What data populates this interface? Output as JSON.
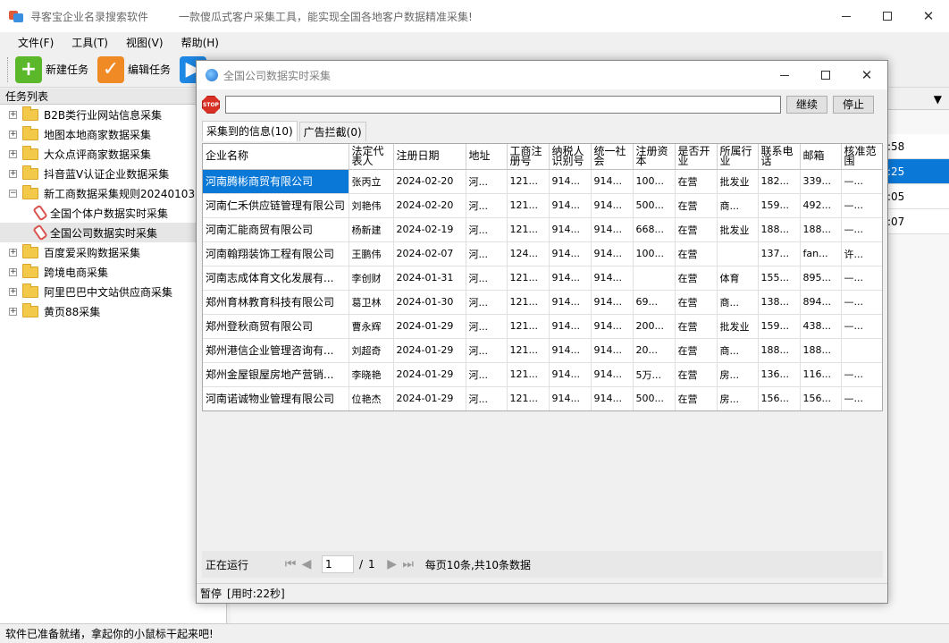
{
  "app": {
    "title": "寻客宝企业名录搜索软件",
    "subtitle": "一款傻瓜式客户采集工具，能实现全国各地客户数据精准采集!"
  },
  "menu": [
    "文件(F)",
    "工具(T)",
    "视图(V)",
    "帮助(H)"
  ],
  "toolbar": {
    "new_task": "新建任务",
    "edit_task": "编辑任务"
  },
  "sidebar": {
    "header": "任务列表",
    "items": [
      {
        "label": "B2B类行业网站信息采集",
        "expander": "+"
      },
      {
        "label": "地图本地商家数据采集",
        "expander": "+"
      },
      {
        "label": "大众点评商家数据采集",
        "expander": "+"
      },
      {
        "label": "抖音蓝V认证企业数据采集",
        "expander": "+"
      },
      {
        "label": "新工商数据采集规则20240103",
        "expander": "−"
      },
      {
        "label": "全国个体户数据实时采集",
        "child": true
      },
      {
        "label": "全国公司数据实时采集",
        "child": true,
        "selected": true
      },
      {
        "label": "百度爱采购数据采集",
        "expander": "+"
      },
      {
        "label": "跨境电商采集",
        "expander": "+"
      },
      {
        "label": "阿里巴巴中文站供应商采集",
        "expander": "+"
      },
      {
        "label": "黄页88采集",
        "expander": "+"
      }
    ]
  },
  "background_cells": [
    ":58",
    ":25",
    ":05",
    ":07"
  ],
  "status_bar": "软件已准备就绪，拿起你的小鼠标干起来吧!",
  "dialog": {
    "title": "全国公司数据实时采集",
    "stop_icon_text": "STOP",
    "url_value": "",
    "continue_label": "继续",
    "stop_label": "停止",
    "tabs": [
      "采集到的信息(10)",
      "广告拦截(0)"
    ],
    "columns": [
      "企业名称",
      "法定代表人",
      "注册日期",
      "地址",
      "工商注册号",
      "纳税人识别号",
      "统一社会",
      "注册资本",
      "是否开业",
      "所属行业",
      "联系电话",
      "邮箱",
      "核准范围"
    ],
    "rows": [
      [
        "河南腾彬商贸有限公司",
        "张丙立",
        "2024-02-20",
        "河...",
        "121...",
        "914...",
        "914...",
        "100...",
        "在营",
        "批发业",
        "182...",
        "339...",
        "—..."
      ],
      [
        "河南仁禾供应链管理有限公司",
        "刘艳伟",
        "2024-02-20",
        "河...",
        "121...",
        "914...",
        "914...",
        "500...",
        "在营",
        "商...",
        "159...",
        "492...",
        "—..."
      ],
      [
        "河南汇能商贸有限公司",
        "杨新建",
        "2024-02-19",
        "河...",
        "121...",
        "914...",
        "914...",
        "668...",
        "在营",
        "批发业",
        "188...",
        "188...",
        "—..."
      ],
      [
        "河南翰翔装饰工程有限公司",
        "王鹏伟",
        "2024-02-07",
        "河...",
        "124...",
        "914...",
        "914...",
        "100...",
        "在营",
        "",
        "137...",
        "fan...",
        "许..."
      ],
      [
        "河南志成体育文化发展有...",
        "李创财",
        "2024-01-31",
        "河...",
        "121...",
        "914...",
        "914...",
        "",
        "在营",
        "体育",
        "155...",
        "895...",
        "—..."
      ],
      [
        "郑州育林教育科技有限公司",
        "葛卫林",
        "2024-01-30",
        "河...",
        "121...",
        "914...",
        "914...",
        "69...",
        "在营",
        "商...",
        "138...",
        "894...",
        "—..."
      ],
      [
        "郑州登秋商贸有限公司",
        "曹永辉",
        "2024-01-29",
        "河...",
        "121...",
        "914...",
        "914...",
        "200...",
        "在营",
        "批发业",
        "159...",
        "438...",
        "—..."
      ],
      [
        "郑州港信企业管理咨询有...",
        "刘超奇",
        "2024-01-29",
        "河...",
        "121...",
        "914...",
        "914...",
        "20...",
        "在营",
        "商...",
        "188...",
        "188...",
        ""
      ],
      [
        "郑州金屋银屋房地产营销...",
        "李晓艳",
        "2024-01-29",
        "河...",
        "121...",
        "914...",
        "914...",
        "5万...",
        "在营",
        "房...",
        "136...",
        "116...",
        "—..."
      ],
      [
        "河南诺诚物业管理有限公司",
        "位艳杰",
        "2024-01-29",
        "河...",
        "121...",
        "914...",
        "914...",
        "500...",
        "在营",
        "房...",
        "156...",
        "156...",
        "—..."
      ]
    ],
    "pager": {
      "status": "正在运行",
      "page": "1",
      "total_pages": "1",
      "separator": "/",
      "info": "每页10条,共10条数据"
    },
    "footer": {
      "state": "暂停",
      "elapsed": "[用时:22秒]"
    }
  }
}
